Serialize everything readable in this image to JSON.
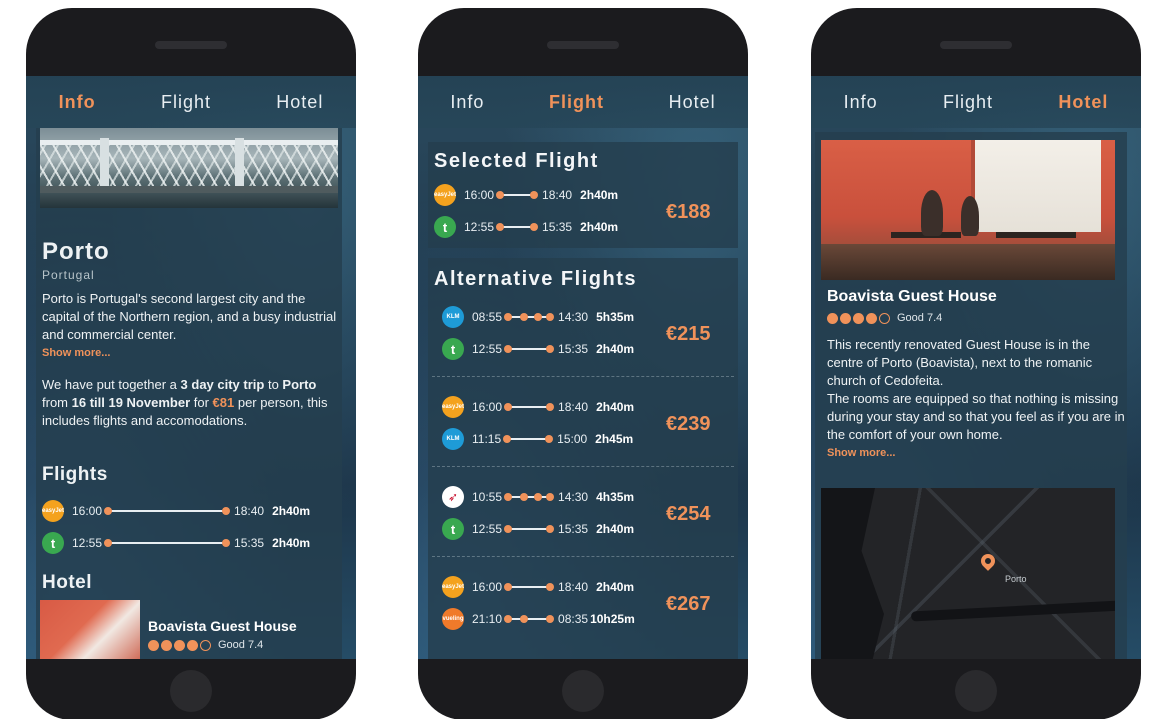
{
  "colors": {
    "accent": "#f0925a",
    "phone_body": "#1b1b1e",
    "panel": "#243e4e"
  },
  "phones": [
    {
      "tabs": [
        {
          "label": "Info",
          "active": true
        },
        {
          "label": "Flight",
          "active": false
        },
        {
          "label": "Hotel",
          "active": false
        }
      ],
      "city": "Porto",
      "country": "Portugal",
      "description": "Porto is Portugal's second largest city and the capital of the Northern region, and a busy industrial and commercial center.",
      "show_more": "Show more...",
      "trip": {
        "t1": "We have put together a ",
        "days": "3 day city trip",
        "t2": " to ",
        "city": "Porto",
        "t3": " from ",
        "dates": "16 till 19 November",
        "t4": " for ",
        "price": "€81",
        "t5": " per person, this includes flights and accomodations."
      },
      "flights_title": "Flights",
      "flights": [
        {
          "airline": "easyJet",
          "logo": "easyjet-logo-icon",
          "dep": "16:00",
          "arr": "18:40",
          "dur": "2h40m"
        },
        {
          "airline": "transavia",
          "logo": "transavia-logo-icon",
          "dep": "12:55",
          "arr": "15:35",
          "dur": "2h40m"
        }
      ],
      "hotel_title": "Hotel",
      "hotel": {
        "name": "Boavista Guest House",
        "stars": 4,
        "max_stars": 5,
        "rating": "Good 7.4"
      }
    },
    {
      "tabs": [
        {
          "label": "Info",
          "active": false
        },
        {
          "label": "Flight",
          "active": true
        },
        {
          "label": "Hotel",
          "active": false
        }
      ],
      "selected_title": "Selected Flight",
      "selected": {
        "price": "€188",
        "legs": [
          {
            "logo": "easyjet-logo-icon",
            "dep": "16:00",
            "arr": "18:40",
            "dur": "2h40m"
          },
          {
            "logo": "transavia-logo-icon",
            "dep": "12:55",
            "arr": "15:35",
            "dur": "2h40m"
          }
        ]
      },
      "alternatives_title": "Alternative Flights",
      "alternatives": [
        {
          "price": "€215",
          "legs": [
            {
              "logo": "klm-logo-icon",
              "dep": "08:55",
              "arr": "14:30",
              "dur": "5h35m",
              "stops": 2
            },
            {
              "logo": "transavia-logo-icon",
              "dep": "12:55",
              "arr": "15:35",
              "dur": "2h40m",
              "stops": 0
            }
          ]
        },
        {
          "price": "€239",
          "legs": [
            {
              "logo": "easyjet-logo-icon",
              "dep": "16:00",
              "arr": "18:40",
              "dur": "2h40m",
              "stops": 0
            },
            {
              "logo": "klm-logo-icon",
              "dep": "11:15",
              "arr": "15:00",
              "dur": "2h45m",
              "stops": 0
            }
          ]
        },
        {
          "price": "€254",
          "legs": [
            {
              "logo": "british-airways-logo-icon",
              "dep": "10:55",
              "arr": "14:30",
              "dur": "4h35m",
              "stops": 2
            },
            {
              "logo": "transavia-logo-icon",
              "dep": "12:55",
              "arr": "15:35",
              "dur": "2h40m",
              "stops": 0
            }
          ]
        },
        {
          "price": "€267",
          "legs": [
            {
              "logo": "easyjet-logo-icon",
              "dep": "16:00",
              "arr": "18:40",
              "dur": "2h40m",
              "stops": 0
            },
            {
              "logo": "vueling-logo-icon",
              "dep": "21:10",
              "arr": "08:35",
              "dur": "10h25m",
              "stops": 1
            }
          ]
        }
      ]
    },
    {
      "tabs": [
        {
          "label": "Info",
          "active": false
        },
        {
          "label": "Flight",
          "active": false
        },
        {
          "label": "Hotel",
          "active": true
        }
      ],
      "hotel": {
        "name": "Boavista Guest House",
        "stars": 4,
        "max_stars": 5,
        "rating": "Good 7.4",
        "description1": "This recently renovated Guest House is in the centre of Porto (Boavista), next to the romanic church of Cedofeita.",
        "description2": "The rooms are equipped so that nothing is missing during your stay and so that you feel as if you are in the comfort of your own home.",
        "show_more": "Show more..."
      },
      "map": {
        "label": "Porto"
      }
    }
  ]
}
